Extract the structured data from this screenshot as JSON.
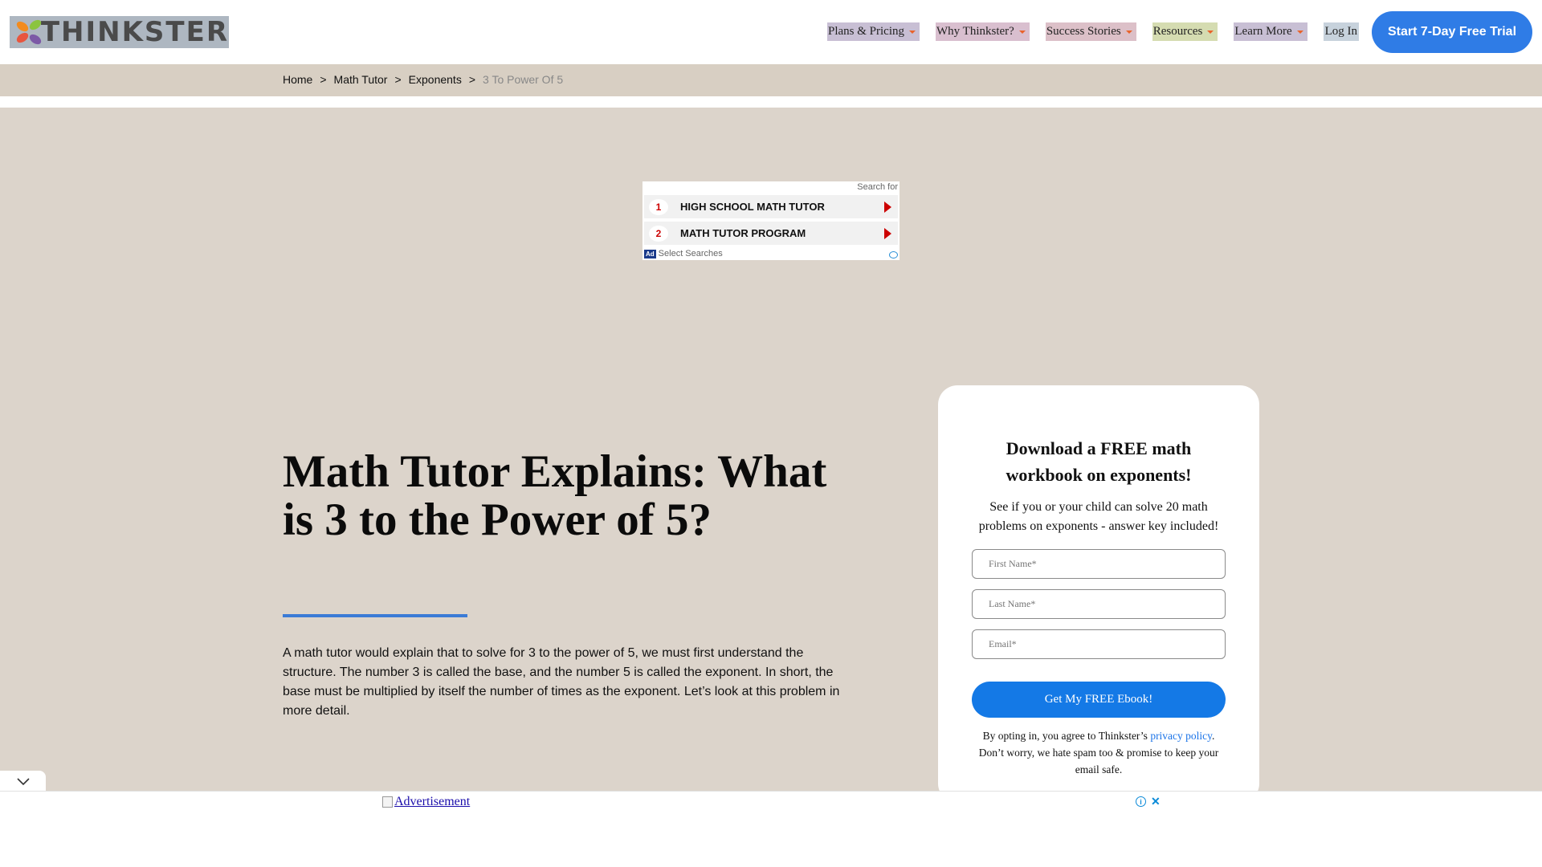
{
  "header": {
    "logo_text": "THINKSTER",
    "nav": [
      {
        "label": "Plans & Pricing"
      },
      {
        "label": "Why Thinkster?"
      },
      {
        "label": "Success Stories"
      },
      {
        "label": "Resources"
      },
      {
        "label": "Learn More"
      }
    ],
    "login_label": "Log In",
    "trial_label": "Start 7-Day Free Trial"
  },
  "breadcrumb": {
    "items": [
      "Home",
      "Math Tutor",
      "Exponents"
    ],
    "current": "3 To Power Of 5",
    "separator": ">"
  },
  "search_ad": {
    "header": "Search for",
    "items": [
      {
        "num": "1",
        "label": "HIGH SCHOOL MATH TUTOR"
      },
      {
        "num": "2",
        "label": "MATH TUTOR PROGRAM"
      }
    ],
    "badge": "Ad",
    "footer": "Select Searches"
  },
  "main": {
    "title": "Math Tutor Explains: What is 3 to the Power of 5?",
    "intro": "A math tutor would explain that to solve for 3 to the power of 5, we must first understand the structure. The number 3 is called the base, and the number 5 is called the exponent. In short, the base must be multiplied by itself the number of times as the exponent. Let’s look at this problem in more detail."
  },
  "form": {
    "title": "Download a FREE math workbook on exponents!",
    "subtitle": "See if you or your child can solve 20 math problems on exponents - answer key included!",
    "first_name_placeholder": "First Name*",
    "last_name_placeholder": "Last Name*",
    "email_placeholder": "Email*",
    "submit_label": "Get My FREE Ebook!",
    "disclaimer_pre": "By opting in, you agree to Thinkster’s ",
    "privacy_link": "privacy policy",
    "disclaimer_post": ". Don’t worry, we hate spam too & promise to keep your email safe."
  },
  "bottom_ad": {
    "alt_text": "Advertisement",
    "info_icon": "info-icon",
    "close_icon": "close-icon"
  },
  "colors": {
    "accent": "#2f7ce6",
    "page_bg": "#dcd4cb",
    "submit": "#1479e6"
  }
}
